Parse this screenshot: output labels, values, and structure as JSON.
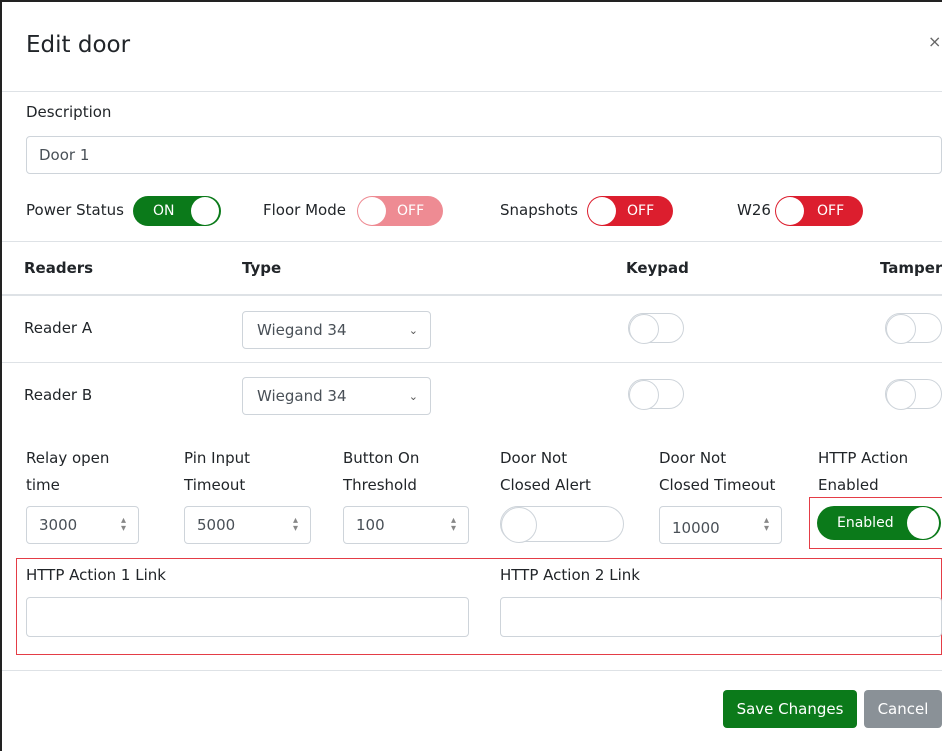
{
  "modal": {
    "title": "Edit door",
    "close_icon": "×"
  },
  "description": {
    "label": "Description",
    "value": "Door 1"
  },
  "switches": [
    {
      "label": "Power Status",
      "state": "ON"
    },
    {
      "label": "Floor Mode",
      "state": "OFF"
    },
    {
      "label": "Snapshots",
      "state": "OFF"
    },
    {
      "label": "W26",
      "state": "OFF"
    }
  ],
  "readers_table": {
    "headers": [
      "Readers",
      "Type",
      "Keypad",
      "Tamper"
    ],
    "rows": [
      {
        "name": "Reader A",
        "type": "Wiegand 34"
      },
      {
        "name": "Reader B",
        "type": "Wiegand 34"
      }
    ]
  },
  "settings": [
    {
      "label_line1": "Relay open",
      "label_line2": "time",
      "value": "3000"
    },
    {
      "label_line1": "Pin Input",
      "label_line2": "Timeout",
      "value": "5000"
    },
    {
      "label_line1": "Button On",
      "label_line2": "Threshold",
      "value": "100"
    },
    {
      "label_line1": "Door Not",
      "label_line2": "Closed Alert"
    },
    {
      "label_line1": "Door Not",
      "label_line2": "Closed Timeout",
      "value": "10000"
    },
    {
      "label_line1": "HTTP Action",
      "label_line2": "Enabled",
      "toggle_label": "Enabled"
    }
  ],
  "http_links": {
    "link1_label": "HTTP Action 1 Link",
    "link1_value": "",
    "link2_label": "HTTP Action 2 Link",
    "link2_value": ""
  },
  "footer": {
    "save_label": "Save Changes",
    "cancel_label": "Cancel"
  },
  "colors": {
    "on_green": "#0b7a1a",
    "off_red": "#dc1e2e",
    "off_red_light": "#ee8b93",
    "cancel_gray": "#8a9197",
    "highlight_red": "#e43d46"
  }
}
